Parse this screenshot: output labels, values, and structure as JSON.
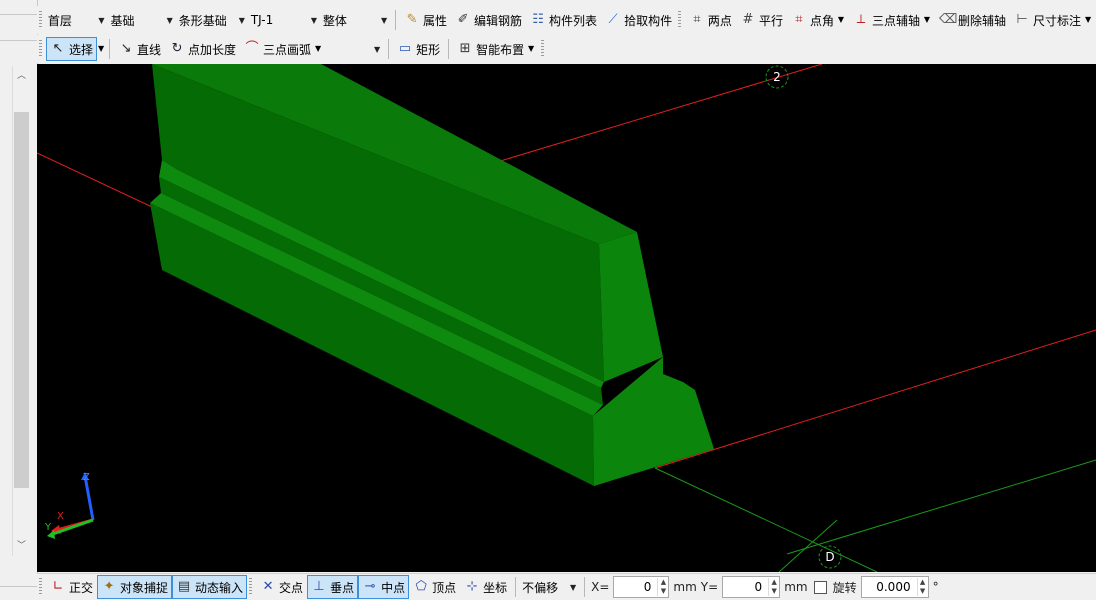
{
  "toolbar1": {
    "floor": "首层",
    "category": "基础",
    "component_type": "条形基础",
    "component": "TJ-1",
    "mode": "整体",
    "properties": "属性",
    "edit_rebar": "编辑钢筋",
    "component_list": "构件列表",
    "pick_component": "拾取构件",
    "two_points": "两点",
    "parallel": "平行",
    "point_angle": "点角",
    "three_point_axis": "三点辅轴",
    "delete_axis": "删除辅轴",
    "dimension": "尺寸标注"
  },
  "toolbar2": {
    "select": "选择",
    "line": "直线",
    "point_length": "点加长度",
    "three_point_arc": "三点画弧",
    "arc_combo_value": "",
    "rectangle": "矩形",
    "smart_layout": "智能布置"
  },
  "viewport": {
    "grid_labels": [
      "2",
      "D"
    ],
    "axes": [
      "Z",
      "X",
      "Y"
    ]
  },
  "statusbar": {
    "ortho": "正交",
    "object_snap": "对象捕捉",
    "dynamic_input": "动态输入",
    "intersection": "交点",
    "perpendicular": "垂点",
    "midpoint": "中点",
    "vertex": "顶点",
    "coordinate": "坐标",
    "offset_mode": "不偏移",
    "x_label": "X=",
    "x_value": "0",
    "y_label": "Y=",
    "y_value": "0",
    "unit_mm": "mm",
    "rotate_label": "旋转",
    "rotate_value": "0.000",
    "degree_symbol": "°"
  },
  "colors": {
    "viewport_bg": "#000000",
    "beam_face_top": "#0a7a0a",
    "beam_face_side": "#056b05",
    "beam_face_end": "#0c850c",
    "axis_red": "#e02020",
    "axis_green": "#1a9a1a",
    "active_btn": "#cce4f7"
  }
}
